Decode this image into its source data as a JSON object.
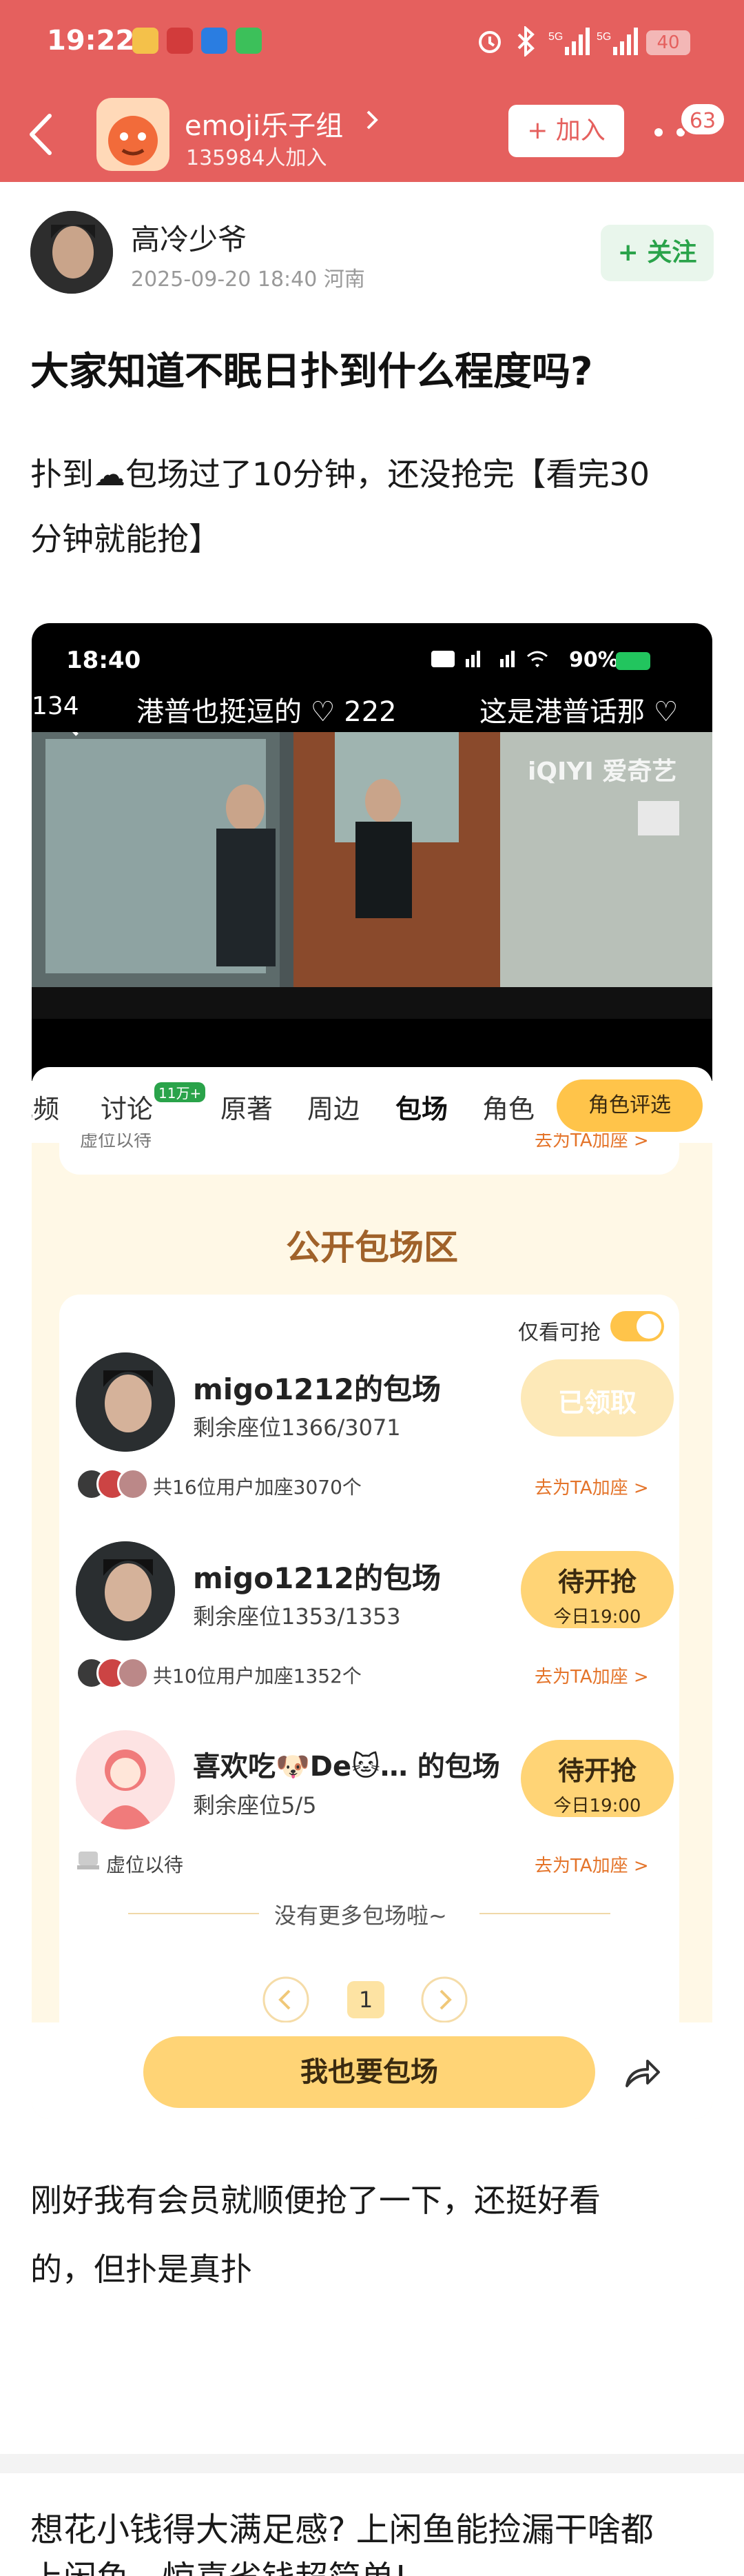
{
  "status_bar": {
    "time": "19:22",
    "battery": "40"
  },
  "group": {
    "name": "emoji乐子组",
    "members": "135984人加入",
    "join_label": "+ 加入",
    "notif_count": "63"
  },
  "post": {
    "author": "高冷少爷",
    "meta": "2025-09-20 18:40  河南",
    "follow_label": "+ 关注",
    "title": "大家知道不眠日扑到什么程度吗?",
    "body_line1": "扑到☁包场过了10分钟，还没抢完【看完30",
    "body_line2": "分钟就能抢】",
    "footer_line1": "刚好我有会员就顺便抢了一下，还挺好看",
    "footer_line2": "的，但扑是真扑"
  },
  "screenshot": {
    "time": "18:40",
    "battery": "90%",
    "danmu_left_num": "134",
    "danmu1": "港普也挺逗的 ♡ 222",
    "danmu2": "这是港普话那 ♡",
    "logo": "iQIYI 爱奇艺",
    "tabs": [
      {
        "label": "视频"
      },
      {
        "label": "讨论"
      },
      {
        "label": "原著"
      },
      {
        "label": "周边"
      },
      {
        "label": "包场"
      },
      {
        "label": "角色"
      }
    ],
    "discuss_badge": "11万+",
    "role_eval": "角色评选",
    "cropped_top_left": "虚位以待",
    "cropped_top_right": "去为TA加座 >",
    "section_title": "公开包场区",
    "only_available": "仅看可抢",
    "venues": [
      {
        "name": "migo1212的包场",
        "seats": "剩余座位1366/3071",
        "joined": "共16位用户加座3070个",
        "btn": "已领取",
        "btn_sub": "",
        "goto": "去为TA加座 >"
      },
      {
        "name": "migo1212的包场",
        "seats": "剩余座位1353/1353",
        "joined": "共10位用户加座1352个",
        "btn": "待开抢",
        "btn_sub": "今日19:00",
        "goto": "去为TA加座 >"
      },
      {
        "name": "喜欢吃🐶De🐱… 的包场",
        "seats": "剩余座位5/5",
        "joined": "虚位以待",
        "btn": "待开抢",
        "btn_sub": "今日19:00",
        "goto": "去为TA加座 >"
      }
    ],
    "no_more": "没有更多包场啦~",
    "page_num": "1",
    "cta": "我也要包场"
  },
  "next_post": {
    "line1": "想花小钱得大满足感? 上闲鱼能捡漏干啥都",
    "line2": "上闲鱼，惊喜省钱超简单!"
  },
  "colors": {
    "brand": "#e5605e",
    "follow_green": "#2aa34a",
    "accent_yellow": "#ffd476",
    "section_title": "#a0622a"
  }
}
